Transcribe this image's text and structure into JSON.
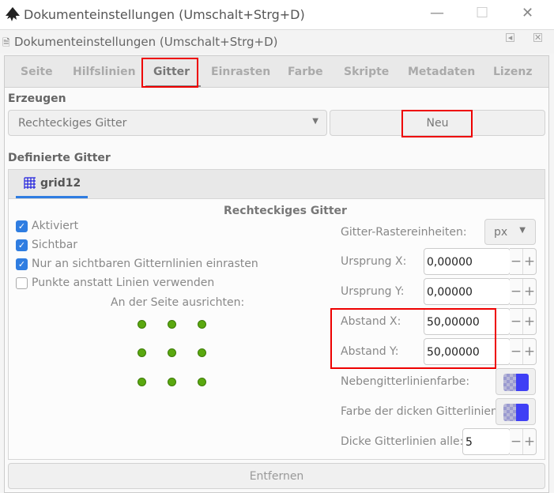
{
  "window": {
    "title": "Dokumenteinstellungen (Umschalt+Strg+D)",
    "minimize": "—",
    "maximize": "☐",
    "close": "✕"
  },
  "dialog": {
    "title": "Dokumenteinstellungen (Umschalt+Strg+D)",
    "dock": "◂",
    "close": "✕"
  },
  "tabs": [
    "Seite",
    "Hilfslinien",
    "Gitter",
    "Einrasten",
    "Farbe",
    "Skripte",
    "Metadaten",
    "Lizenz"
  ],
  "create": {
    "label": "Erzeugen",
    "type": "Rechteckiges Gitter",
    "new_button": "Neu"
  },
  "defined": {
    "label": "Definierte Gitter",
    "grid_tab": "grid12"
  },
  "grid": {
    "heading": "Rechteckiges Gitter",
    "checkboxes": [
      {
        "label": "Aktiviert",
        "checked": true
      },
      {
        "label": "Sichtbar",
        "checked": true
      },
      {
        "label": "Nur an sichtbaren Gitternlinien einrasten",
        "checked": true
      },
      {
        "label": "Punkte anstatt Linien verwenden",
        "checked": false
      }
    ],
    "align_label": "An der Seite ausrichten:",
    "units_label": "Gitter-Rastereinheiten:",
    "units": "px",
    "origin_x_label": "Ursprung X:",
    "origin_x": "0,00000",
    "origin_y_label": "Ursprung Y:",
    "origin_y": "0,00000",
    "spacing_x_label": "Abstand X:",
    "spacing_x": "50,00000",
    "spacing_y_label": "Abstand Y:",
    "spacing_y": "50,00000",
    "minor_color_label": "Nebengitterlinienfarbe:",
    "major_color_label": "Farbe der dicken Gitterlinien:",
    "major_every_label": "Dicke Gitterlinien alle:",
    "major_every": "5",
    "grid_color": "#3f3ff5"
  },
  "remove_button": "Entfernen"
}
